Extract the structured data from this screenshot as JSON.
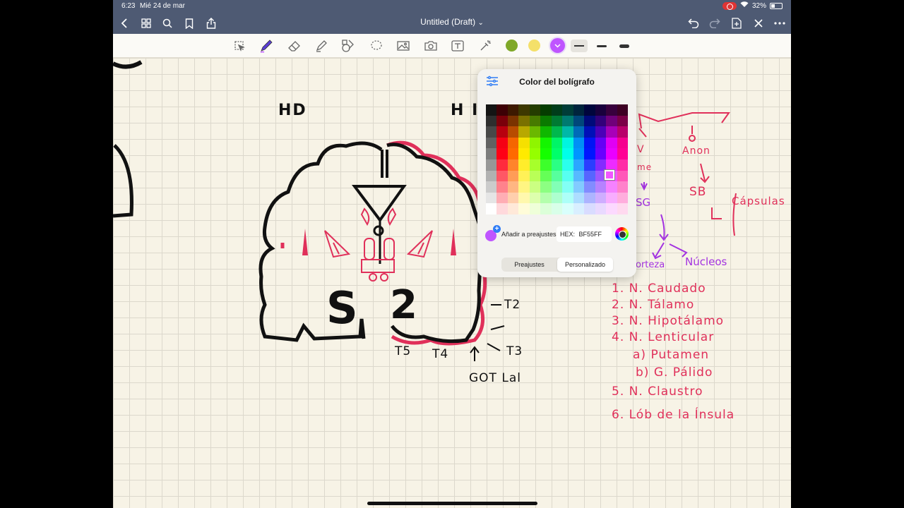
{
  "status": {
    "time": "6:23",
    "date": "Mié 24 de mar",
    "battery": "32%"
  },
  "nav": {
    "title": "Untitled (Draft)",
    "title_chevron": "⌄"
  },
  "icons": {
    "back": "chevron-left-icon",
    "grid": "thumbnails-icon",
    "search": "search-icon",
    "bookmark": "bookmark-icon",
    "share": "share-icon",
    "undo": "undo-icon",
    "redo": "redo-icon",
    "add_page": "add-page-icon",
    "close": "close-icon",
    "more": "more-icon"
  },
  "toolbar": {
    "tools": [
      "select-tool",
      "pen-tool",
      "eraser-tool",
      "highlighter-tool",
      "shapes-tool",
      "lasso-tool",
      "image-tool",
      "camera-tool",
      "text-tool",
      "laser-tool"
    ],
    "active_tool": "pen-tool",
    "swatches": [
      "#7fa828",
      "#f4e06a",
      "#bf55ff"
    ],
    "active_swatch": "#bf55ff"
  },
  "notes": {
    "hd": "HD",
    "hi": "H I",
    "t2": "T2",
    "t3": "T3",
    "t4": "T4",
    "t5": "T5",
    "got": "GOT Lal",
    "s": "S",
    "two": "2",
    "list": [
      "1. N. Caudado",
      "2. N. Tálamo",
      "3. N. Hipotálamo",
      "4. N. Lenticular",
      "a) Putamen",
      "b) G. Pálido",
      "5. N. Claustro",
      "6. Lób de la Ínsula"
    ],
    "anon": "Anon",
    "sb": "SB",
    "capsulas": "Cápsulas",
    "nucleos": "Núcleos",
    "sg": "SG",
    "corteza": "orteza",
    "me": "me",
    "v": "V"
  },
  "popover": {
    "title": "Color del bolígrafo",
    "add_preset": "Añadir a preajustes",
    "hex_label": "HEX:",
    "hex_value": "BF55FF",
    "tab_presets": "Preajustes",
    "tab_custom": "Personalizado",
    "active_tab": "Personalizado"
  },
  "colors": {
    "accent": "#2f7df6",
    "pen": "#bf55ff",
    "navbar": "#4e5a73",
    "paper": "#f7f3e6"
  }
}
